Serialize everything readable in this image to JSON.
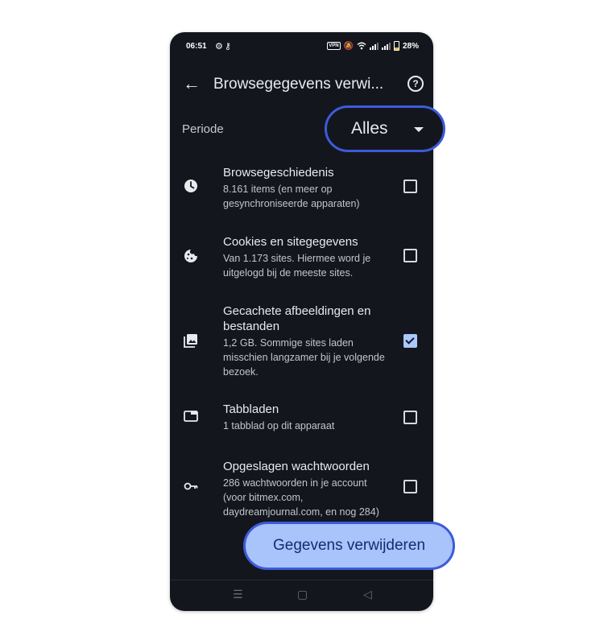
{
  "status": {
    "time": "06:51",
    "vpn": "VPN",
    "battery": "28%"
  },
  "appbar": {
    "back_icon": "arrow-left",
    "title": "Browsegegevens verwi...",
    "help_icon": "question-circle"
  },
  "periode": {
    "label": "Periode",
    "value": "Alles"
  },
  "items": [
    {
      "icon": "clock-icon",
      "title": "Browsegeschiedenis",
      "subtitle": "8.161 items (en meer op gesynchroniseerde apparaten)",
      "checked": false
    },
    {
      "icon": "cookie-icon",
      "title": "Cookies en sitegegevens",
      "subtitle": "Van 1.173 sites. Hiermee word je uitgelogd bij de meeste sites.",
      "checked": false
    },
    {
      "icon": "image-icon",
      "title": "Gecachete afbeeldingen en bestanden",
      "subtitle": "1,2 GB. Sommige sites laden misschien langzamer bij je volgende bezoek.",
      "checked": true
    },
    {
      "icon": "tab-icon",
      "title": "Tabbladen",
      "subtitle": "1 tabblad op dit apparaat",
      "checked": false
    },
    {
      "icon": "key-icon",
      "title": "Opgeslagen wachtwoorden",
      "subtitle": "286 wachtwoorden in je account (voor bitmex.com, daydreamjournal.com, en nog 284)",
      "checked": false
    }
  ],
  "action": {
    "label": "Gegevens verwijderen"
  },
  "colors": {
    "background": "#13161d",
    "accent": "#3d5bd9",
    "button": "#a9c3fb",
    "checkbox_checked": "#aac7ff"
  }
}
